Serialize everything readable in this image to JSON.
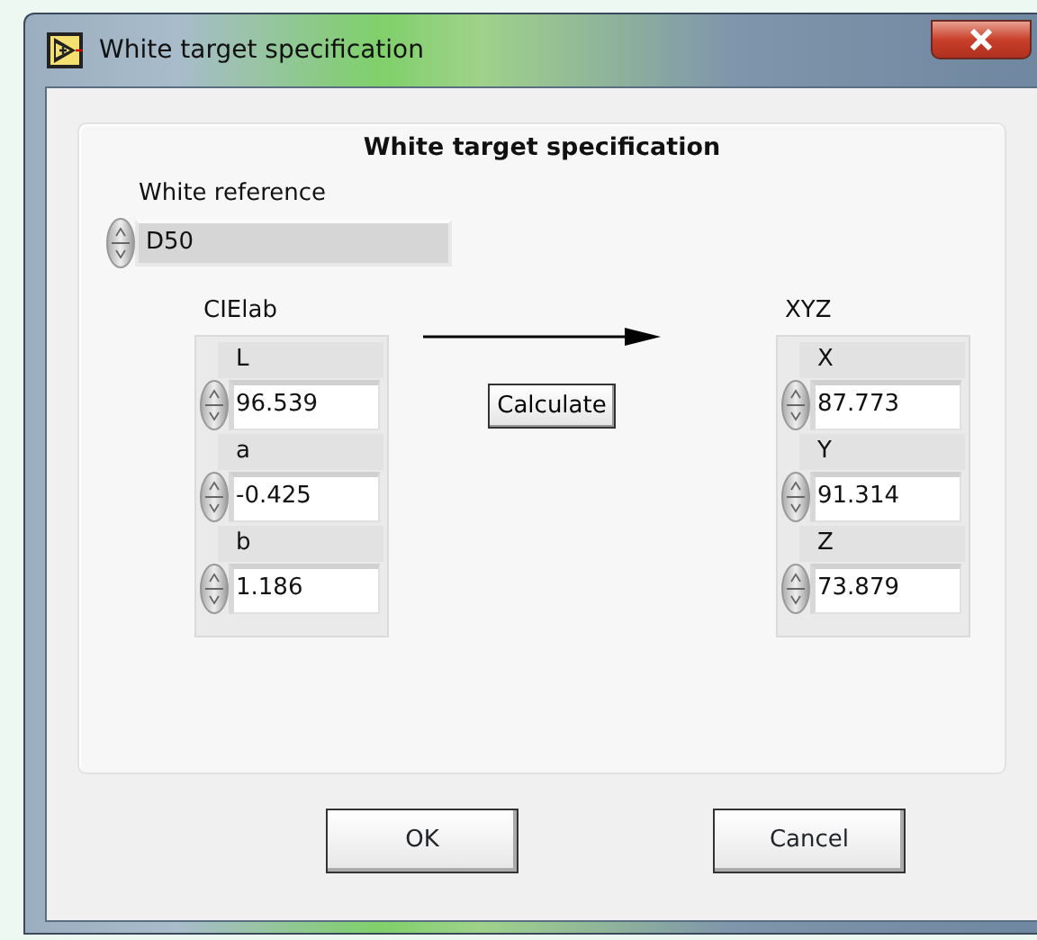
{
  "window": {
    "title": "White target specification"
  },
  "panel": {
    "title": "White target specification",
    "white_reference": {
      "label": "White reference",
      "value": "D50"
    },
    "clusters": [
      {
        "label": "CIElab",
        "fields": [
          {
            "label": "L",
            "value": "96.539"
          },
          {
            "label": "a",
            "value": "-0.425"
          },
          {
            "label": "b",
            "value": "1.186"
          }
        ]
      },
      {
        "label": "XYZ",
        "fields": [
          {
            "label": "X",
            "value": "87.773"
          },
          {
            "label": "Y",
            "value": "91.314"
          },
          {
            "label": "Z",
            "value": "73.879"
          }
        ]
      }
    ],
    "calculate_button": "Calculate"
  },
  "buttons": [
    "OK",
    "Cancel"
  ]
}
